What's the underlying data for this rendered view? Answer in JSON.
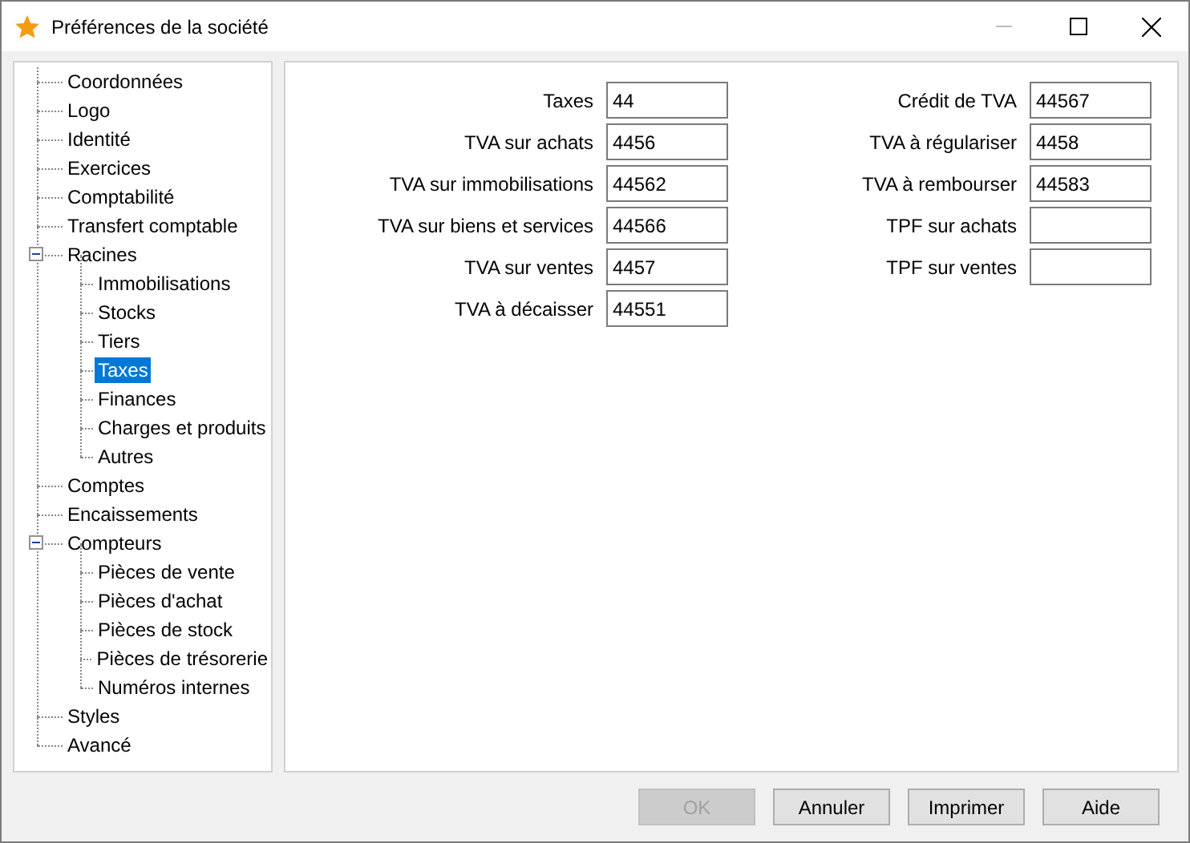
{
  "window": {
    "title": "Préférences de la société"
  },
  "tree": [
    {
      "label": "Coordonnées",
      "selected": false
    },
    {
      "label": "Logo",
      "selected": false
    },
    {
      "label": "Identité",
      "selected": false
    },
    {
      "label": "Exercices",
      "selected": false
    },
    {
      "label": "Comptabilité",
      "selected": false
    },
    {
      "label": "Transfert comptable",
      "selected": false
    },
    {
      "label": "Racines",
      "selected": false,
      "expanded": true,
      "children": [
        {
          "label": "Immobilisations",
          "selected": false
        },
        {
          "label": "Stocks",
          "selected": false
        },
        {
          "label": "Tiers",
          "selected": false
        },
        {
          "label": "Taxes",
          "selected": true
        },
        {
          "label": "Finances",
          "selected": false
        },
        {
          "label": "Charges et produits",
          "selected": false
        },
        {
          "label": "Autres",
          "selected": false
        }
      ]
    },
    {
      "label": "Comptes",
      "selected": false
    },
    {
      "label": "Encaissements",
      "selected": false
    },
    {
      "label": "Compteurs",
      "selected": false,
      "expanded": true,
      "children": [
        {
          "label": "Pièces de vente",
          "selected": false
        },
        {
          "label": "Pièces d'achat",
          "selected": false
        },
        {
          "label": "Pièces de stock",
          "selected": false
        },
        {
          "label": "Pièces de trésorerie",
          "selected": false
        },
        {
          "label": "Numéros internes",
          "selected": false
        }
      ]
    },
    {
      "label": "Styles",
      "selected": false
    },
    {
      "label": "Avancé",
      "selected": false
    }
  ],
  "form": {
    "left": [
      {
        "label": "Taxes",
        "value": "44"
      },
      {
        "label": "TVA sur achats",
        "value": "4456"
      },
      {
        "label": "TVA sur immobilisations",
        "value": "44562"
      },
      {
        "label": "TVA sur biens et services",
        "value": "44566"
      },
      {
        "label": "TVA sur ventes",
        "value": "4457"
      },
      {
        "label": "TVA à décaisser",
        "value": "44551"
      }
    ],
    "right": [
      {
        "label": "Crédit de TVA",
        "value": "44567"
      },
      {
        "label": "TVA à régulariser",
        "value": "4458"
      },
      {
        "label": "TVA à rembourser",
        "value": "44583"
      },
      {
        "label": "TPF sur achats"
      },
      {
        "label": "TPF sur ventes"
      }
    ]
  },
  "buttons": [
    {
      "label": "OK",
      "disabled": true
    },
    {
      "label": "Annuler",
      "disabled": false
    },
    {
      "label": "Imprimer",
      "disabled": false
    },
    {
      "label": "Aide",
      "disabled": false
    }
  ]
}
